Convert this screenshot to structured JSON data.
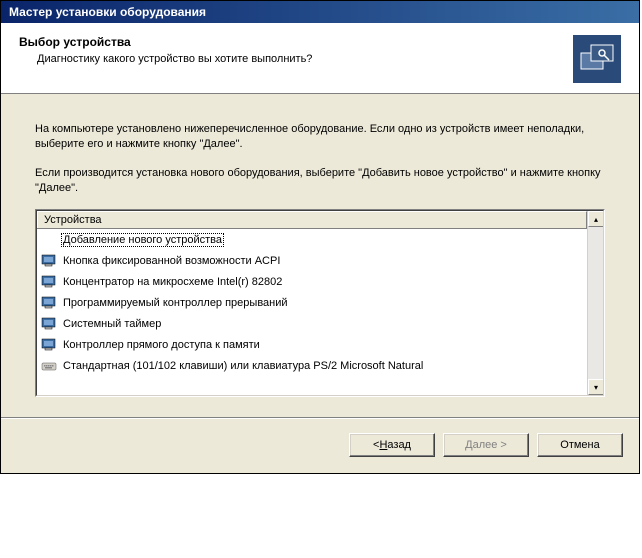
{
  "title": "Мастер установки оборудования",
  "header": {
    "title": "Выбор устройства",
    "subtitle": "Диагностику какого устройство вы хотите выполнить?"
  },
  "instructions": {
    "p1": "На компьютере установлено нижеперечисленное оборудование. Если одно из устройств имеет неполадки, выберите его и нажмите кнопку \"Далее\".",
    "p2": "Если производится установка нового оборудования, выберите \"Добавить новое устройство\" и нажмите кнопку \"Далее\"."
  },
  "list": {
    "column": "Устройства",
    "items": [
      {
        "icon": "none",
        "label": "Добавление нового устройства",
        "selected": true
      },
      {
        "icon": "monitor",
        "label": "Кнопка фиксированной возможности ACPI"
      },
      {
        "icon": "monitor",
        "label": "Концентратор на микросхеме Intel(r) 82802"
      },
      {
        "icon": "monitor",
        "label": "Программируемый контроллер прерываний"
      },
      {
        "icon": "monitor",
        "label": "Системный таймер"
      },
      {
        "icon": "monitor",
        "label": "Контроллер прямого доступа к памяти"
      },
      {
        "icon": "keyboard",
        "label": "Стандартная (101/102 клавиши) или клавиатура PS/2 Microsoft Natural"
      }
    ]
  },
  "buttons": {
    "back_prefix": "< ",
    "back_ul": "Н",
    "back_rest": "азад",
    "next_ul": "Д",
    "next_rest": "алее >",
    "cancel": "Отмена"
  }
}
